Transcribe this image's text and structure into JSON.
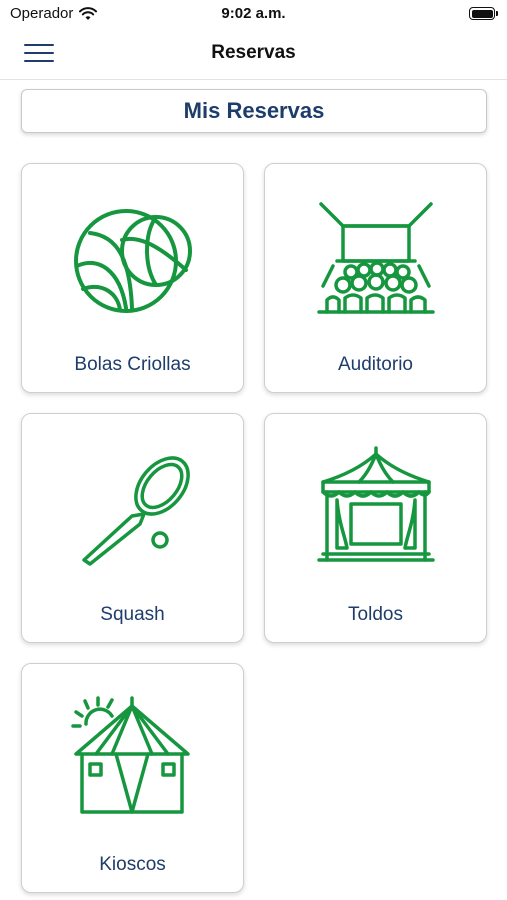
{
  "status_bar": {
    "carrier": "Operador",
    "time": "9:02 a.m."
  },
  "nav": {
    "title": "Reservas"
  },
  "my_reservations": {
    "label": "Mis Reservas"
  },
  "accent_color": "#16973f",
  "text_color": "#1e3d6b",
  "items": [
    {
      "label": "Bolas Criollas",
      "icon": "bocce-balls-icon"
    },
    {
      "label": "Auditorio",
      "icon": "auditorium-icon"
    },
    {
      "label": "Squash",
      "icon": "squash-racket-icon"
    },
    {
      "label": "Toldos",
      "icon": "tent-canopy-icon"
    },
    {
      "label": "Kioscos",
      "icon": "kiosk-tent-icon"
    }
  ]
}
